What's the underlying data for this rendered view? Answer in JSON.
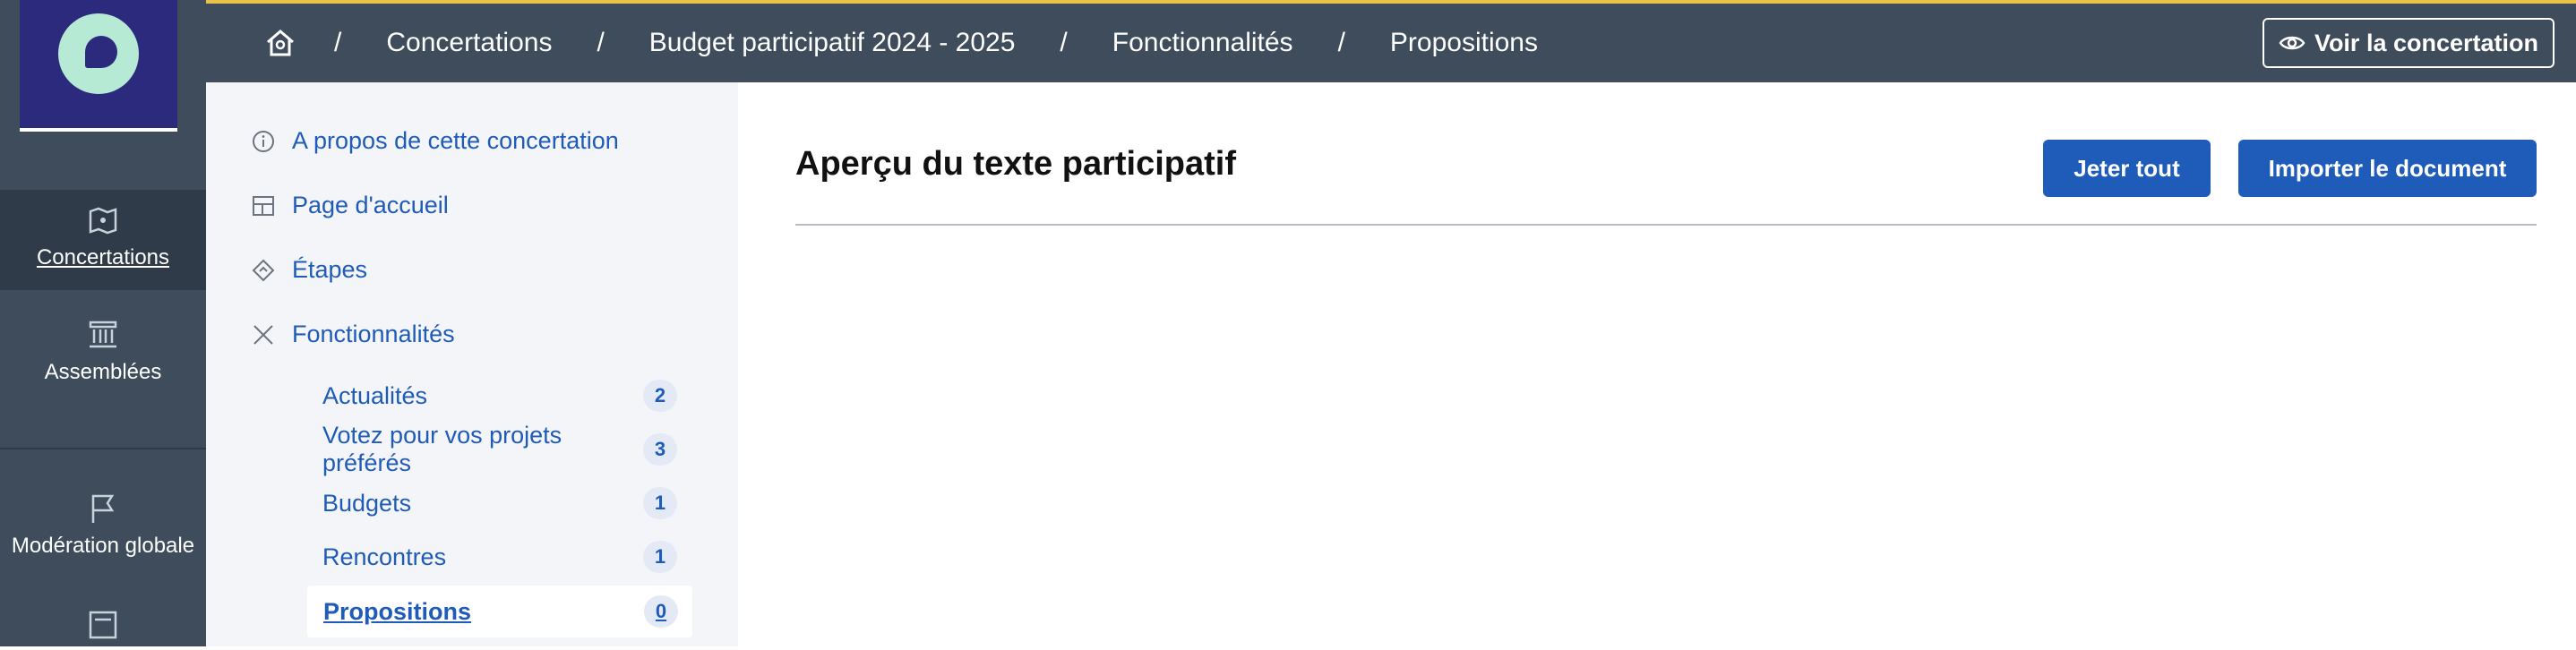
{
  "leftnav": {
    "items": [
      {
        "label": "Concertations",
        "icon": "map-icon",
        "active": true
      },
      {
        "label": "Assemblées",
        "icon": "institution-icon",
        "active": false
      },
      {
        "label": "Modération globale",
        "icon": "flag-icon",
        "active": false
      }
    ]
  },
  "topbar": {
    "breadcrumbs": [
      "Concertations",
      "Budget participatif 2024 - 2025",
      "Fonctionnalités",
      "Propositions"
    ],
    "separator": "/",
    "view_button": "Voir la concertation"
  },
  "subnav": {
    "items": [
      {
        "label": "A propos de cette concertation",
        "icon": "info-icon"
      },
      {
        "label": "Page d'accueil",
        "icon": "layout-icon"
      },
      {
        "label": "Étapes",
        "icon": "steps-icon"
      },
      {
        "label": "Fonctionnalités",
        "icon": "tools-icon"
      }
    ],
    "children": [
      {
        "label": "Actualités",
        "count": "2"
      },
      {
        "label": "Votez pour vos projets préférés",
        "count": "3"
      },
      {
        "label": "Budgets",
        "count": "1"
      },
      {
        "label": "Rencontres",
        "count": "1"
      },
      {
        "label": "Propositions",
        "count": "0"
      }
    ]
  },
  "main": {
    "title": "Aperçu du texte participatif",
    "discard_button": "Jeter tout",
    "import_button": "Importer le document"
  },
  "colors": {
    "nav_bg": "#3e4c5c",
    "accent_bar": "#e8c34a",
    "primary": "#1f5bb8",
    "logo_bg": "#2b2a7c"
  }
}
